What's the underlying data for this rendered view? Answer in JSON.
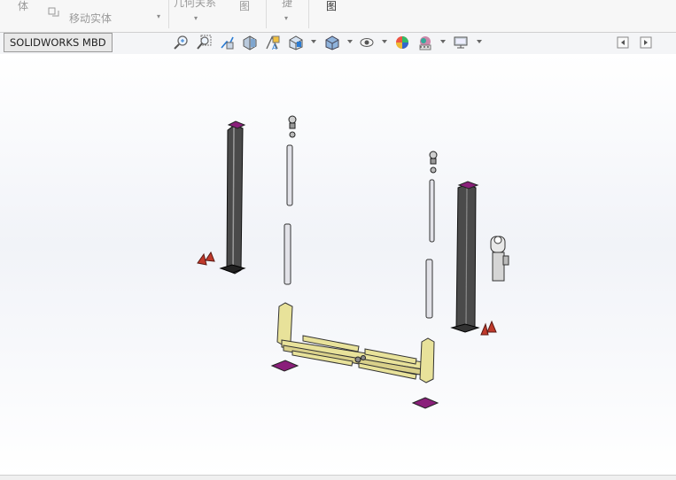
{
  "ribbon": {
    "items": [
      "体",
      "移动实体",
      "几何关系",
      "图",
      "捷",
      "图"
    ]
  },
  "tabs": {
    "mbd_label": "SOLIDWORKS MBD"
  },
  "toolbar": {
    "icons": [
      "zoom-to-fit-icon",
      "zoom-to-area-icon",
      "previous-view-icon",
      "section-view-icon",
      "dynamic-annotation-view-icon",
      "view-orientation-icon",
      "display-style-icon",
      "hide-show-items-icon",
      "edit-appearance-icon",
      "apply-scene-icon",
      "view-settings-icon"
    ],
    "right_icons": [
      "collapse-left-panel-icon",
      "expand-right-panel-icon"
    ]
  },
  "colors": {
    "column_dark": "#4a4a4a",
    "cap_purple": "#8a1f7a",
    "yellow_part": "#e8e29a",
    "red_part": "#c0392b"
  }
}
